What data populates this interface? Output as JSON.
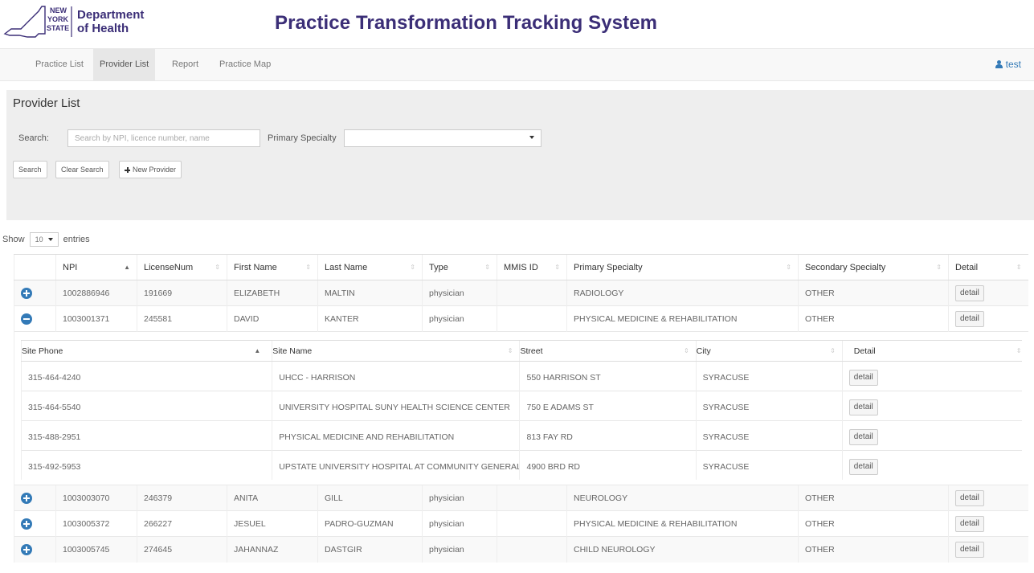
{
  "header": {
    "logo_state_line1": "NEW",
    "logo_state_line2": "YORK",
    "logo_state_line3": "STATE",
    "logo_dept_line1": "Department",
    "logo_dept_line2": "of Health",
    "app_title": "Practice Transformation Tracking System"
  },
  "nav": {
    "items": [
      {
        "label": "Practice List"
      },
      {
        "label": "Provider List"
      },
      {
        "label": "Report"
      },
      {
        "label": "Practice Map"
      }
    ],
    "active": "Provider List",
    "user": "test"
  },
  "panel": {
    "title": "Provider List",
    "search_label": "Search:",
    "search_placeholder": "Search by NPI, licence number, name",
    "specialty_label": "Primary Specialty",
    "buttons": {
      "search": "Search",
      "clear": "Clear Search",
      "new_provider": "New Provider"
    }
  },
  "entries": {
    "show": "Show",
    "value": "10",
    "suffix": "entries"
  },
  "table": {
    "columns": [
      "",
      "NPI",
      "LicenseNum",
      "First Name",
      "Last Name",
      "Type",
      "MMIS ID",
      "Primary Specialty",
      "Secondary Specialty",
      "Detail"
    ],
    "detail_label": "detail",
    "rows": [
      {
        "expanded": false,
        "npi": "1002886946",
        "license": "191669",
        "first": "ELIZABETH",
        "last": "MALTIN",
        "type": "physician",
        "mmis": "",
        "primary": "RADIOLOGY",
        "secondary": "OTHER"
      },
      {
        "expanded": true,
        "npi": "1003001371",
        "license": "245581",
        "first": "DAVID",
        "last": "KANTER",
        "type": "physician",
        "mmis": "",
        "primary": "PHYSICAL MEDICINE & REHABILITATION",
        "secondary": "OTHER"
      },
      {
        "expanded": false,
        "npi": "1003003070",
        "license": "246379",
        "first": "ANITA",
        "last": "GILL",
        "type": "physician",
        "mmis": "",
        "primary": "NEUROLOGY",
        "secondary": "OTHER"
      },
      {
        "expanded": false,
        "npi": "1003005372",
        "license": "266227",
        "first": "JESUEL",
        "last": "PADRO-GUZMAN",
        "type": "physician",
        "mmis": "",
        "primary": "PHYSICAL MEDICINE & REHABILITATION",
        "secondary": "OTHER"
      },
      {
        "expanded": false,
        "npi": "1003005745",
        "license": "274645",
        "first": "JAHANNAZ",
        "last": "DASTGIR",
        "type": "physician",
        "mmis": "",
        "primary": "CHILD NEUROLOGY",
        "secondary": "OTHER"
      }
    ]
  },
  "sites": {
    "columns": [
      "Site Phone",
      "Site Name",
      "Street",
      "City",
      "Detail"
    ],
    "rows": [
      {
        "phone": "315-464-4240",
        "name": "UHCC - HARRISON",
        "street": "550 HARRISON ST",
        "city": "SYRACUSE"
      },
      {
        "phone": "315-464-5540",
        "name": "UNIVERSITY HOSPITAL SUNY HEALTH SCIENCE CENTER",
        "street": "750 E ADAMS ST",
        "city": "SYRACUSE"
      },
      {
        "phone": "315-488-2951",
        "name": "PHYSICAL MEDICINE AND REHABILITATION",
        "street": "813 FAY RD",
        "city": "SYRACUSE"
      },
      {
        "phone": "315-492-5953",
        "name": "UPSTATE UNIVERSITY HOSPITAL AT COMMUNITY GENERAL",
        "street": "4900 BRD RD",
        "city": "SYRACUSE"
      }
    ]
  },
  "colors": {
    "title": "#3b2e77",
    "accent": "#337ab7"
  }
}
